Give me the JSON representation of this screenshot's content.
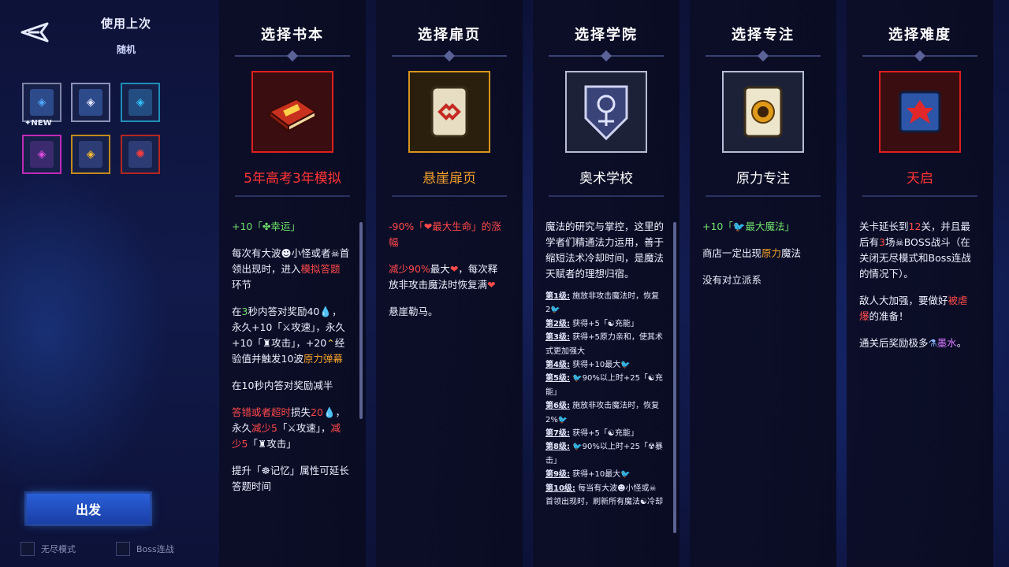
{
  "preset": {
    "title": "使用上次",
    "random": "随机",
    "new_badge": "✦NEW"
  },
  "slots": [
    {
      "border": "#7d83a6",
      "icon": "#4fa8ff"
    },
    {
      "border": "#8d93b8",
      "icon": "#e3e7ff"
    },
    {
      "border": "#1e8fb8",
      "icon": "#34c3ff"
    },
    {
      "border": "#c02bb6",
      "icon": "#e04de0"
    },
    {
      "border": "#c48a1c",
      "icon": "#ffbf2e"
    },
    {
      "border": "#b52620",
      "icon": "#ff3d3d"
    }
  ],
  "depart_label": "出发",
  "toggles": {
    "endless": "无尽模式",
    "boss_rush": "Boss连战"
  },
  "columns": {
    "book": {
      "heading": "选择书本",
      "name": "5年高考3年模拟",
      "name_color": "#ff3434",
      "border": "#e01f1f",
      "desc": {
        "p1a": "+10「",
        "p1icon": "✤",
        "p1b": "幸运」",
        "p2a": "每次有大波",
        "p2b": "☻",
        "p2c": "小怪或者",
        "p2d": "☠",
        "p2e": "首领出现时，进入",
        "p2f": "模拟答题",
        "p2g": "环节",
        "p3a": "在",
        "p3b": "3",
        "p3c": "秒内答对奖励40",
        "p3d": "💧",
        "p3e": "，永久+10「",
        "p3f": "⚔",
        "p3g": "攻速」，永久+10「",
        "p3h": "♜",
        "p3i": "攻击」，+20",
        "p3j": "⌃",
        "p3k": "经验值并触发10波",
        "p3l": "原力弹幕",
        "p4": "在10秒内答对奖励减半",
        "p5a": "答错或者超时",
        "p5b": "损失",
        "p5c": "20",
        "p5d": "💧",
        "p5e": "，永久",
        "p5f": "减少5",
        "p5g": "「",
        "p5h": "⚔",
        "p5i": "攻速」，",
        "p5j": "减少5",
        "p5k": "「",
        "p5l": "♜",
        "p5m": "攻击」",
        "p6a": "提升「",
        "p6b": "☸",
        "p6c": "记忆」属性可延长答题时间"
      }
    },
    "page": {
      "heading": "选择扉页",
      "name": "悬崖扉页",
      "name_color": "#f2a02a",
      "border": "#d8951c",
      "desc": {
        "p1a": "-90%「",
        "p1b": "❤",
        "p1c": "最大生命」的涨幅",
        "p2a": "减少90%",
        "p2b": "最大",
        "p2c": "❤",
        "p2d": "，每次释放非攻击魔法时恢复满",
        "p2e": "❤",
        "p3": "悬崖勒马。"
      }
    },
    "academy": {
      "heading": "选择学院",
      "name": "奥术学校",
      "name_color": "#ffffff",
      "border": "#b8bcd4",
      "intro": "魔法的研究与掌控，这里的学者们精通法力运用，善于缩短法术冷却时间，是魔法天赋者的理想归宿。",
      "levels": [
        {
          "lv": "第1级:",
          "text": "施放非攻击魔法时，恢复2🐦"
        },
        {
          "lv": "第2级:",
          "text": "获得+5「☯充能」"
        },
        {
          "lv": "第3级:",
          "text": "获得+5原力亲和，使其术式更加强大"
        },
        {
          "lv": "第4级:",
          "text": "获得+10最大🐦"
        },
        {
          "lv": "第5级:",
          "text": "🐦90%以上时+25「☯充能」"
        },
        {
          "lv": "第6级:",
          "text": "施放非攻击魔法时，恢复2%🐦"
        },
        {
          "lv": "第7级:",
          "text": "获得+5「☯充能」"
        },
        {
          "lv": "第8级:",
          "text": "🐦90%以上时+25「☢暴击」"
        },
        {
          "lv": "第9级:",
          "text": "获得+10最大🐦"
        },
        {
          "lv": "第10级:",
          "text": "每当有大波☻小怪或☠首领出现时，刷新所有魔法☯冷却"
        }
      ]
    },
    "focus": {
      "heading": "选择专注",
      "name": "原力专注",
      "name_color": "#ffffff",
      "border": "#b8bcd4",
      "desc": {
        "p1a": "+10「",
        "p1b": "🐦",
        "p1c": "最大魔法」",
        "p2a": "商店一定出现",
        "p2b": "原力",
        "p2c": "魔法",
        "p3": "没有对立派系"
      }
    },
    "difficulty": {
      "heading": "选择难度",
      "name": "天启",
      "name_color": "#ff3434",
      "border": "#e01f1f",
      "desc": {
        "p1a": "关卡延长到",
        "p1b": "12",
        "p1c": "关，并且最后有",
        "p1d": "3",
        "p1e": "场",
        "p1f": "☠",
        "p1g": "BOSS战斗（在关闭无尽模式和Boss连战的情况下）。",
        "p2a": "敌人大加强，要做好",
        "p2b": "被虐爆",
        "p2c": "的准备！",
        "p3a": "通关后奖励极多",
        "p3b": "⚗",
        "p3c": "墨水",
        "p3d": "。"
      }
    }
  },
  "colors": {
    "green": "#6fe06a",
    "red": "#ff4a4a",
    "orange": "#f2a02a",
    "blue": "#4fa8ff"
  },
  "icons": [
    "back-arrow-icon",
    "book-icon",
    "scroll-page-icon",
    "academy-shield-icon",
    "focus-page-icon",
    "apocalypse-banner-icon"
  ]
}
